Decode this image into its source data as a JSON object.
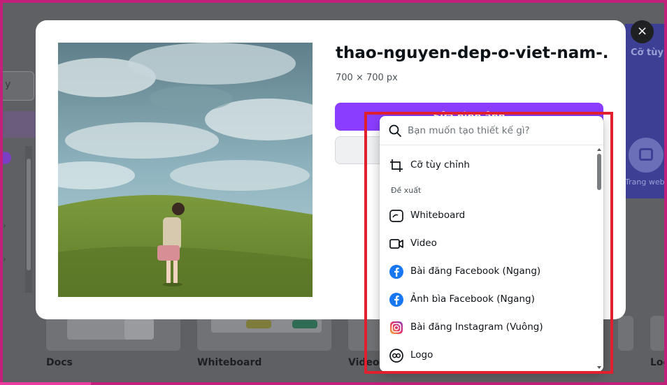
{
  "background": {
    "search_text": "y",
    "right_panel_label": "Cỡ tùy",
    "right_panel_icon_label": "Trang web",
    "cards": [
      {
        "label": "Docs"
      },
      {
        "label": "Whiteboard"
      },
      {
        "label": "Video"
      },
      {
        "label": "Log"
      }
    ]
  },
  "modal": {
    "title": "thao-nguyen-dep-o-viet-nam-...",
    "dimensions": "700 × 700 px",
    "edit_button_label": "Sửa hình ảnh",
    "close_label": "×"
  },
  "dropdown": {
    "search_placeholder": "Bạn muốn tạo thiết kế gì?",
    "custom_size_label": "Cỡ tùy chỉnh",
    "section_label": "Đề xuất",
    "items": [
      {
        "label": "Whiteboard",
        "icon": "whiteboard-icon"
      },
      {
        "label": "Video",
        "icon": "video-icon"
      },
      {
        "label": "Bài đăng Facebook (Ngang)",
        "icon": "facebook-icon"
      },
      {
        "label": "Ảnh bìa Facebook (Ngang)",
        "icon": "facebook-icon"
      },
      {
        "label": "Bài đăng Instagram (Vuông)",
        "icon": "instagram-icon"
      },
      {
        "label": "Logo",
        "icon": "logo-icon"
      }
    ]
  },
  "colors": {
    "accent": "#8b3dff",
    "highlight_frame": "#e0202e",
    "facebook": "#1877f2"
  }
}
